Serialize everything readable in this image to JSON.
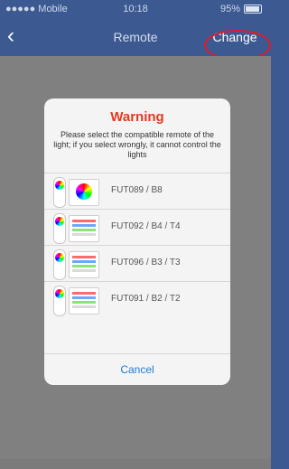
{
  "status_bar": {
    "carrier": "●●●●● Mobile",
    "time": "10:18",
    "battery": "95%"
  },
  "nav": {
    "back_icon": "‹",
    "title": "Remote",
    "change_label": "Change",
    "highlight_color": "#e21b2b"
  },
  "dialog": {
    "title": "Warning",
    "message": "Please select the compatible remote of the light; if you select wrongly, it cannot control the lights",
    "options": [
      {
        "label": "FUT089 / B8"
      },
      {
        "label": "FUT092 / B4 / T4"
      },
      {
        "label": "FUT096 / B3 / T3"
      },
      {
        "label": "FUT091 / B2 / T2"
      }
    ],
    "cancel_label": "Cancel"
  },
  "colors": {
    "header": "#3c5a91",
    "overlay": "#808080",
    "warning": "#e63a1e",
    "link": "#1f7cd8"
  }
}
